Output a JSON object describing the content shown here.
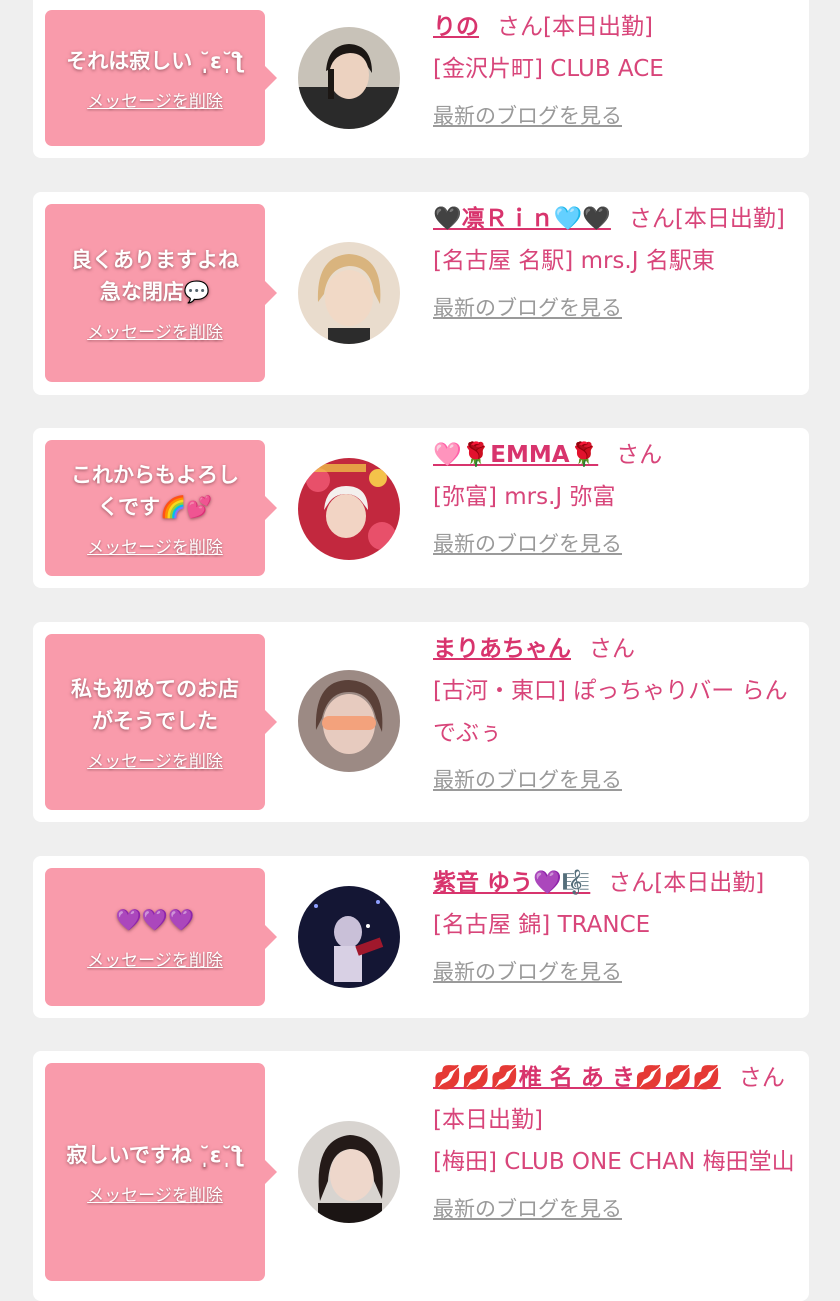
{
  "accent_color": "#d8346d",
  "bubble_color": "#f99bab",
  "messages": [
    {
      "bubble_text": "それは寂しい ˘̩̩̩ε˘̩ƪ",
      "delete_label": "メッセージを削除",
      "name": "りの",
      "suffix": "さん[本日出勤]",
      "shop": "[金沢片町] CLUB ACE",
      "blog_label": "最新のブログを見る"
    },
    {
      "bubble_text": "良くありますよね\n急な閉店💬",
      "delete_label": "メッセージを削除",
      "name": "🖤凛Ｒｉｎ🩵🖤",
      "suffix": "さん[本日出勤]",
      "shop": "[名古屋 名駅] mrs.J 名駅東",
      "blog_label": "最新のブログを見る"
    },
    {
      "bubble_text": "これからもよろし\nくです🌈💕",
      "delete_label": "メッセージを削除",
      "name": "🩷🌹EMMA🌹",
      "suffix": "さん",
      "shop": "[弥富] mrs.J 弥富",
      "blog_label": "最新のブログを見る"
    },
    {
      "bubble_text": "私も初めてのお店\nがそうでした",
      "delete_label": "メッセージを削除",
      "name": "まりあちゃん",
      "suffix": "さん",
      "shop": "[古河・東口] ぽっちゃりバー らんでぶぅ",
      "blog_label": "最新のブログを見る"
    },
    {
      "bubble_text": "💜💜💜",
      "delete_label": "メッセージを削除",
      "name": "紫音 ゆう💜🎼",
      "suffix": "さん[本日出勤]",
      "shop": "[名古屋 錦] TRANCE",
      "blog_label": "最新のブログを見る"
    },
    {
      "bubble_text": "寂しいですね ˘̩̩̩ε˘̩ƪ",
      "delete_label": "メッセージを削除",
      "name": "💋💋💋椎 名 あ き💋💋💋",
      "suffix": "さん[本日出勤]",
      "shop": "[梅田] CLUB ONE CHAN 梅田堂山",
      "blog_label": "最新のブログを見る"
    }
  ]
}
